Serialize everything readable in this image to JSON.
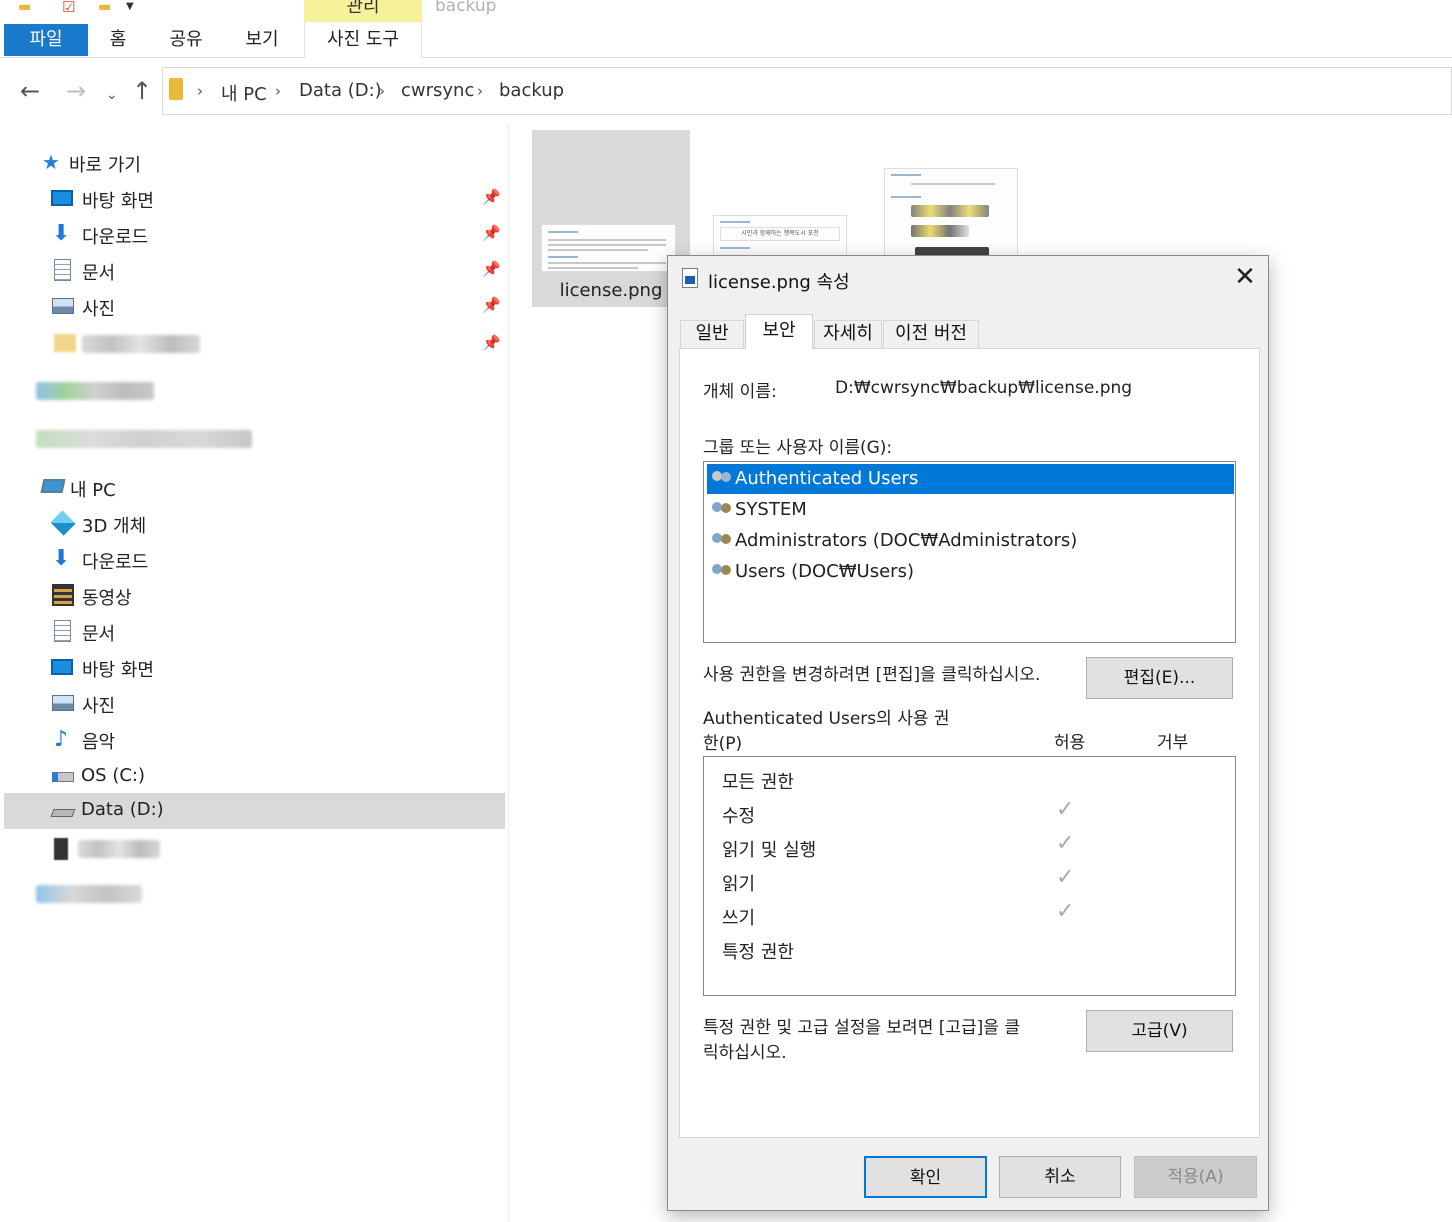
{
  "ribbon": {
    "contextual_tab": "관리",
    "window_title": "backup",
    "tabs": [
      "파일",
      "홈",
      "공유",
      "보기",
      "사진 도구"
    ]
  },
  "address": {
    "crumbs": [
      "내 PC",
      "Data (D:)",
      "cwrsync",
      "backup"
    ]
  },
  "navpane": {
    "quick_access": "바로 가기",
    "quick_items": [
      "바탕 화면",
      "다운로드",
      "문서",
      "사진"
    ],
    "this_pc": "내 PC",
    "pc_items": [
      "3D 개체",
      "다운로드",
      "동영상",
      "문서",
      "바탕 화면",
      "사진",
      "음악",
      "OS (C:)",
      "Data (D:)"
    ]
  },
  "content": {
    "selected_file": "license.png",
    "thumb_text": "시민과 함께하는 행복도시 포천"
  },
  "dialog": {
    "title": "license.png 속성",
    "close": "✕",
    "tabs": [
      "일반",
      "보안",
      "자세히",
      "이전 버전"
    ],
    "object_name_label": "개체 이름:",
    "object_name_value": "D:₩cwrsync₩backup₩license.png",
    "group_label": "그룹 또는 사용자 이름(G):",
    "users": [
      "Authenticated Users",
      "SYSTEM",
      "Administrators (DOC₩Administrators)",
      "Users (DOC₩Users)"
    ],
    "edit_hint": "사용 권한을 변경하려면 [편집]을 클릭하십시오.",
    "edit_button": "편집(E)...",
    "perm_label_1": "Authenticated Users의 사용 권",
    "perm_label_2": "한(P)",
    "allow_header": "허용",
    "deny_header": "거부",
    "permissions": [
      {
        "name": "모든 권한",
        "allow": false
      },
      {
        "name": "수정",
        "allow": true
      },
      {
        "name": "읽기 및 실행",
        "allow": true
      },
      {
        "name": "읽기",
        "allow": true
      },
      {
        "name": "쓰기",
        "allow": true
      },
      {
        "name": "특정 권한",
        "allow": false
      }
    ],
    "check_glyph": "✓",
    "advanced_hint_1": "특정 권한 및 고급 설정을 보려면 [고급]을 클",
    "advanced_hint_2": "릭하십시오.",
    "advanced_button": "고급(V)",
    "ok_button": "확인",
    "cancel_button": "취소",
    "apply_button": "적용(A)"
  },
  "colors": {
    "accent": "#0078d7",
    "file_tab": "#1979ca",
    "contextual": "#f6f19a",
    "selection_grey": "#d9d9d9"
  }
}
